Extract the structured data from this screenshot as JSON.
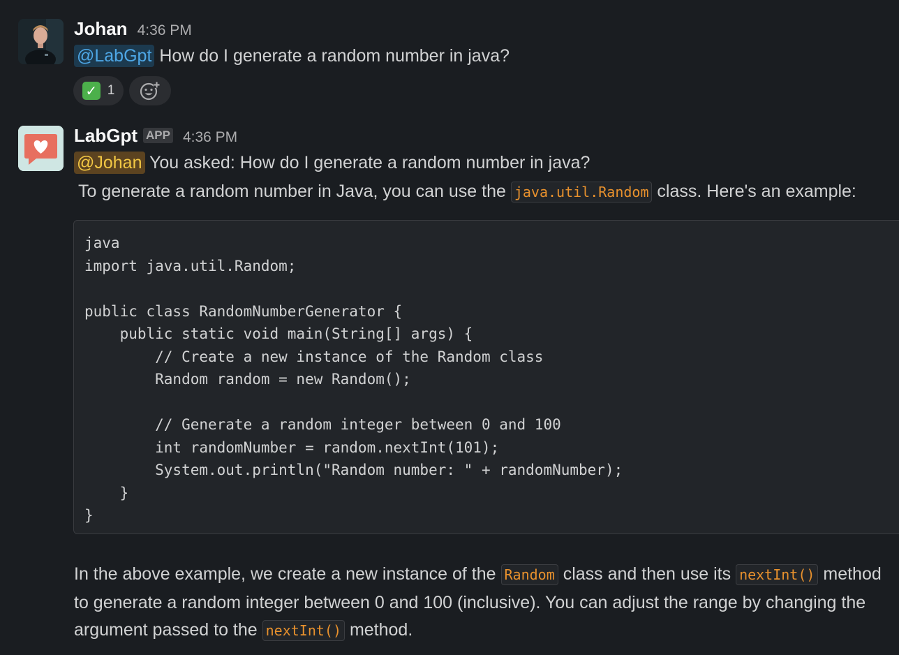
{
  "top_partial_text": "",
  "messages": [
    {
      "author": "Johan",
      "time": "4:36 PM",
      "mention": "@LabGpt",
      "text": " How do I generate a random number in java?",
      "reactions": [
        {
          "emoji": "white-check-mark",
          "count": "1"
        }
      ]
    },
    {
      "author": "LabGpt",
      "badge": "APP",
      "time": "4:36 PM",
      "mention": "@Johan",
      "text": " You asked: How do I generate a random number in java?",
      "intro_before": "To generate a random number in Java, you can use the ",
      "intro_code": "java.util.Random",
      "intro_after": " class. Here's an example:",
      "code_block": "java\nimport java.util.Random;\n\npublic class RandomNumberGenerator {\n    public static void main(String[] args) {\n        // Create a new instance of the Random class\n        Random random = new Random();\n\n        // Generate a random integer between 0 and 100\n        int randomNumber = random.nextInt(101);\n        System.out.println(\"Random number: \" + randomNumber);\n    }\n}",
      "explanation": {
        "p1": "In the above example, we create a new instance of the ",
        "c1": "Random",
        "p2": " class and then use its ",
        "c2": "nextInt()",
        "p3": " method to generate a random integer between 0 and 100 (inclusive). You can adjust the range by changing the argument passed to the ",
        "c3": "nextInt()",
        "p4": " method."
      }
    }
  ],
  "colors": {
    "background": "#1a1d21",
    "mention_bot": "#4ea7e6",
    "mention_user": "#f2c744",
    "inline_code": "#e8912d",
    "check": "#4cb04b"
  },
  "icons": {
    "add_reaction": "add-reaction-icon",
    "check": "white-check-mark-icon",
    "labgpt_avatar": "heart-speech-bubble-icon"
  }
}
